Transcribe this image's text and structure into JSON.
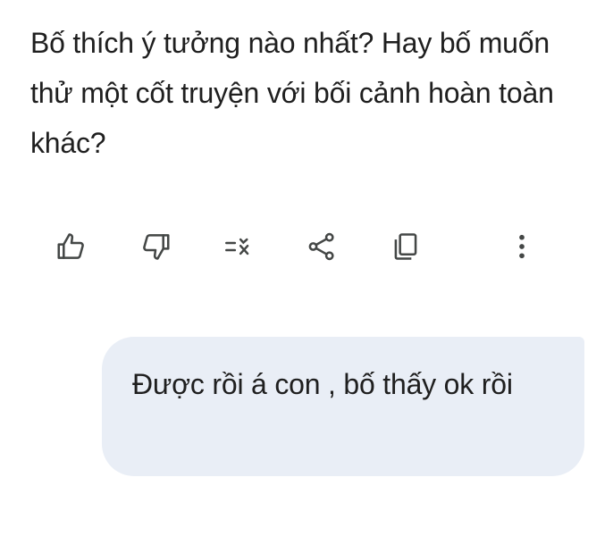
{
  "assistant": {
    "message": "Bố thích ý tưởng nào nhất? Hay bố muốn thử một cốt truyện với bối cảnh hoàn toàn khác?"
  },
  "actions": [
    {
      "name": "like",
      "icon": "thumb-up-icon"
    },
    {
      "name": "dislike",
      "icon": "thumb-down-icon"
    },
    {
      "name": "modify-response",
      "icon": "tune-icon"
    },
    {
      "name": "share",
      "icon": "share-icon"
    },
    {
      "name": "copy",
      "icon": "copy-icon"
    },
    {
      "name": "more",
      "icon": "more-vert-icon"
    }
  ],
  "user": {
    "message": "Được rồi á con , bố thấy ok rồi"
  },
  "colors": {
    "text": "#1f1f1f",
    "icon": "#444746",
    "user_bubble": "#e9eef6",
    "background": "#ffffff"
  }
}
